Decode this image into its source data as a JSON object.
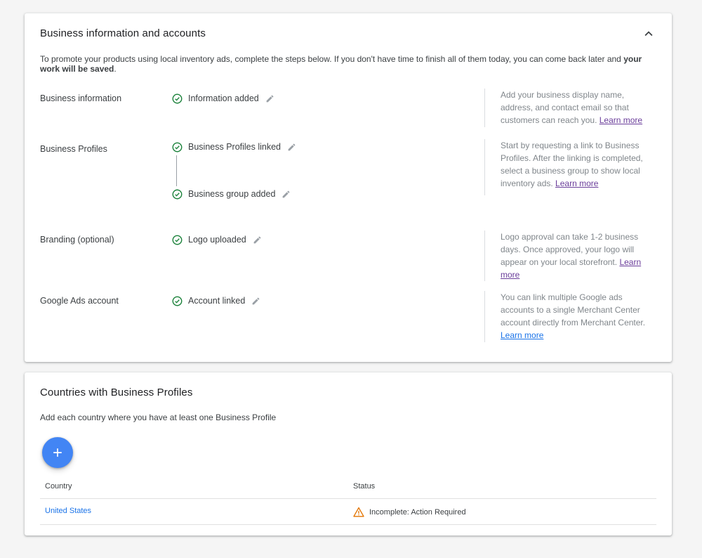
{
  "business_card": {
    "title": "Business information and accounts",
    "intro_text": "To promote your products using local inventory ads, complete the steps below. If you don't have time to finish all of them today, you can come back later and ",
    "intro_bold": "your work will be saved",
    "intro_end": ".",
    "rows": [
      {
        "label": "Business information",
        "steps": [
          "Information added"
        ],
        "help": "Add your business display name, address, and contact email so that customers can reach you. ",
        "help_link": "Learn more"
      },
      {
        "label": "Business Profiles",
        "steps": [
          "Business Profiles linked",
          "Business group added"
        ],
        "help": "Start by requesting a link to Business Profiles. After the linking is completed, select a business group to show local inventory ads. ",
        "help_link": "Learn more"
      },
      {
        "label": "Branding (optional)",
        "steps": [
          "Logo uploaded"
        ],
        "help": "Logo approval can take 1-2 business days. Once approved, your logo will appear on your local storefront. ",
        "help_link": "Learn more"
      },
      {
        "label": "Google Ads account",
        "steps": [
          "Account linked"
        ],
        "help": "You can link multiple Google ads accounts to a single Merchant Center account directly from Merchant Center. ",
        "help_link": "Learn more"
      }
    ]
  },
  "countries_card": {
    "title": "Countries with Business Profiles",
    "subtitle": "Add each country where you have at least one Business Profile",
    "table": {
      "headers": [
        "Country",
        "Status"
      ],
      "rows": [
        {
          "country": "United States",
          "status": "Incomplete: Action Required"
        }
      ]
    }
  },
  "colors": {
    "check": "#188038",
    "fab": "#4285f4",
    "link_blue": "#1a73e8",
    "link_visited": "#6a3d9a",
    "warning": "#e37400"
  },
  "icons": {
    "collapse": "chevron-up-icon",
    "step_done": "check-circle-icon",
    "edit": "pencil-icon",
    "add": "plus-icon",
    "warning": "warning-triangle-icon"
  }
}
